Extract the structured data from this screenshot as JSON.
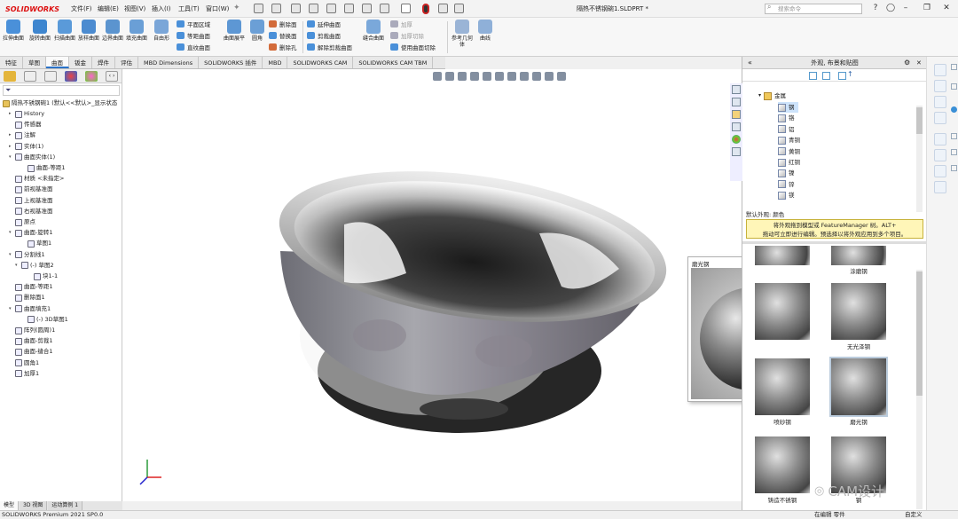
{
  "app": {
    "brand": "SOLIDWORKS",
    "filename": "隔热不锈钢碗1.SLDPRT *",
    "search_placeholder": "搜索命令"
  },
  "menu": [
    "文件(F)",
    "编辑(E)",
    "视图(V)",
    "插入(I)",
    "工具(T)",
    "窗口(W)"
  ],
  "toolbar": {
    "big": [
      "拉伸曲面",
      "旋转曲面",
      "扫描曲面",
      "放样曲面",
      "边界曲面",
      "填充曲面",
      "自由形",
      "曲面展平",
      "圆角",
      "缝合曲面",
      "参考几何体",
      "曲线"
    ],
    "small_col1": [
      "平面区域",
      "等距曲面",
      "直纹曲面"
    ],
    "small_col2": [
      "删除面",
      "替换面",
      "删除孔"
    ],
    "small_col3": [
      "延伸曲面",
      "剪裁曲面",
      "解除剪裁曲面"
    ],
    "small_col4": [
      "加厚",
      "加厚切除",
      "使用曲面切除"
    ]
  },
  "tabs": [
    "特征",
    "草图",
    "曲面",
    "钣金",
    "焊件",
    "评估",
    "MBD Dimensions",
    "SOLIDWORKS 插件",
    "MBD",
    "SOLIDWORKS CAM",
    "SOLIDWORKS CAM TBM"
  ],
  "active_tab": "曲面",
  "tree": {
    "root": "隔热不锈钢碗1 (默认<<默认>_显示状态",
    "items": [
      {
        "label": "History",
        "indent": 1,
        "tw": "▸"
      },
      {
        "label": "传感器",
        "indent": 1,
        "tw": ""
      },
      {
        "label": "注解",
        "indent": 1,
        "tw": "▸"
      },
      {
        "label": "实体(1)",
        "indent": 1,
        "tw": "▸"
      },
      {
        "label": "曲面实体(1)",
        "indent": 1,
        "tw": "▾"
      },
      {
        "label": "曲面-等距1",
        "indent": 3,
        "tw": ""
      },
      {
        "label": "材质 <未指定>",
        "indent": 1,
        "tw": ""
      },
      {
        "label": "前视基准面",
        "indent": 1,
        "tw": ""
      },
      {
        "label": "上视基准面",
        "indent": 1,
        "tw": ""
      },
      {
        "label": "右视基准面",
        "indent": 1,
        "tw": ""
      },
      {
        "label": "原点",
        "indent": 1,
        "tw": ""
      },
      {
        "label": "曲面-旋转1",
        "indent": 1,
        "tw": "▾"
      },
      {
        "label": "草图1",
        "indent": 3,
        "tw": ""
      },
      {
        "label": "分割线1",
        "indent": 1,
        "tw": "▾"
      },
      {
        "label": "(-) 草图2",
        "indent": 2,
        "tw": "▾"
      },
      {
        "label": "块1-1",
        "indent": 4,
        "tw": ""
      },
      {
        "label": "曲面-等距1",
        "indent": 1,
        "tw": ""
      },
      {
        "label": "删除面1",
        "indent": 1,
        "tw": ""
      },
      {
        "label": "曲面填充1",
        "indent": 1,
        "tw": "▾"
      },
      {
        "label": "(-) 3D草图1",
        "indent": 3,
        "tw": ""
      },
      {
        "label": "阵列(圆周)1",
        "indent": 1,
        "tw": ""
      },
      {
        "label": "曲面-剪裁1",
        "indent": 1,
        "tw": ""
      },
      {
        "label": "曲面-缝合1",
        "indent": 1,
        "tw": ""
      },
      {
        "label": "圆角1",
        "indent": 1,
        "tw": ""
      },
      {
        "label": "加厚1",
        "indent": 1,
        "tw": ""
      }
    ]
  },
  "bottom_tabs": [
    "模型",
    "3D 视图",
    "运动算例 1"
  ],
  "status": {
    "product": "SOLIDWORKS Premium 2021 SP0.0",
    "editing": "在编辑 零件",
    "custom": "自定义"
  },
  "taskpane": {
    "title": "外观, 布景和贴图",
    "root": "金属",
    "materials": [
      "钢",
      "铬",
      "铝",
      "青铜",
      "黄铜",
      "红铜",
      "镍",
      "锌",
      "镁"
    ],
    "selected_material": "钢",
    "default_label": "默认外观: 颜色",
    "tooltip_line1": "将外观拖到模型或 FeatureManager 树。ALT+",
    "tooltip_line2": "拖动可立即进行编辑。预选择以将外观应用到多个项目。",
    "thumbs": [
      "",
      "涂磨钢",
      "",
      "无光泽钢",
      "喷砂钢",
      "磨光钢",
      "铸造不锈钢",
      "钢"
    ],
    "preview_title": "磨光钢"
  },
  "watermark": "CAM设计"
}
